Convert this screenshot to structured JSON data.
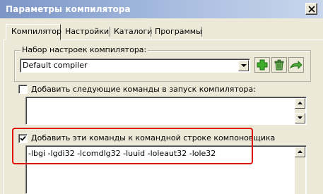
{
  "window": {
    "title": "Параметры компилятора"
  },
  "tabs": [
    {
      "label": "Компилятор",
      "active": true
    },
    {
      "label": "Настройки",
      "active": false
    },
    {
      "label": "Каталоги",
      "active": false
    },
    {
      "label": "Программы",
      "active": false
    }
  ],
  "compiler_set": {
    "group_label": "Набор настроек компилятора:",
    "selected": "Default compiler"
  },
  "compile_commands": {
    "label": "Добавить следующие команды в запуск компилятора:",
    "checked": false,
    "value": ""
  },
  "linker_commands": {
    "label": "Добавить эти команды к командной строке компоновщика",
    "checked": true,
    "value": "-lbgi -lgdi32 -lcomdlg32 -luuid -loleaut32 -lole32"
  },
  "colors": {
    "highlight": "#e01010",
    "title_start": "#7b95c6",
    "face": "#ece9d8"
  },
  "icons": [
    "close-icon",
    "chevron-down-icon",
    "add-icon",
    "delete-icon",
    "rename-icon",
    "scroll-up-icon",
    "scroll-down-icon",
    "checkmark-icon"
  ]
}
